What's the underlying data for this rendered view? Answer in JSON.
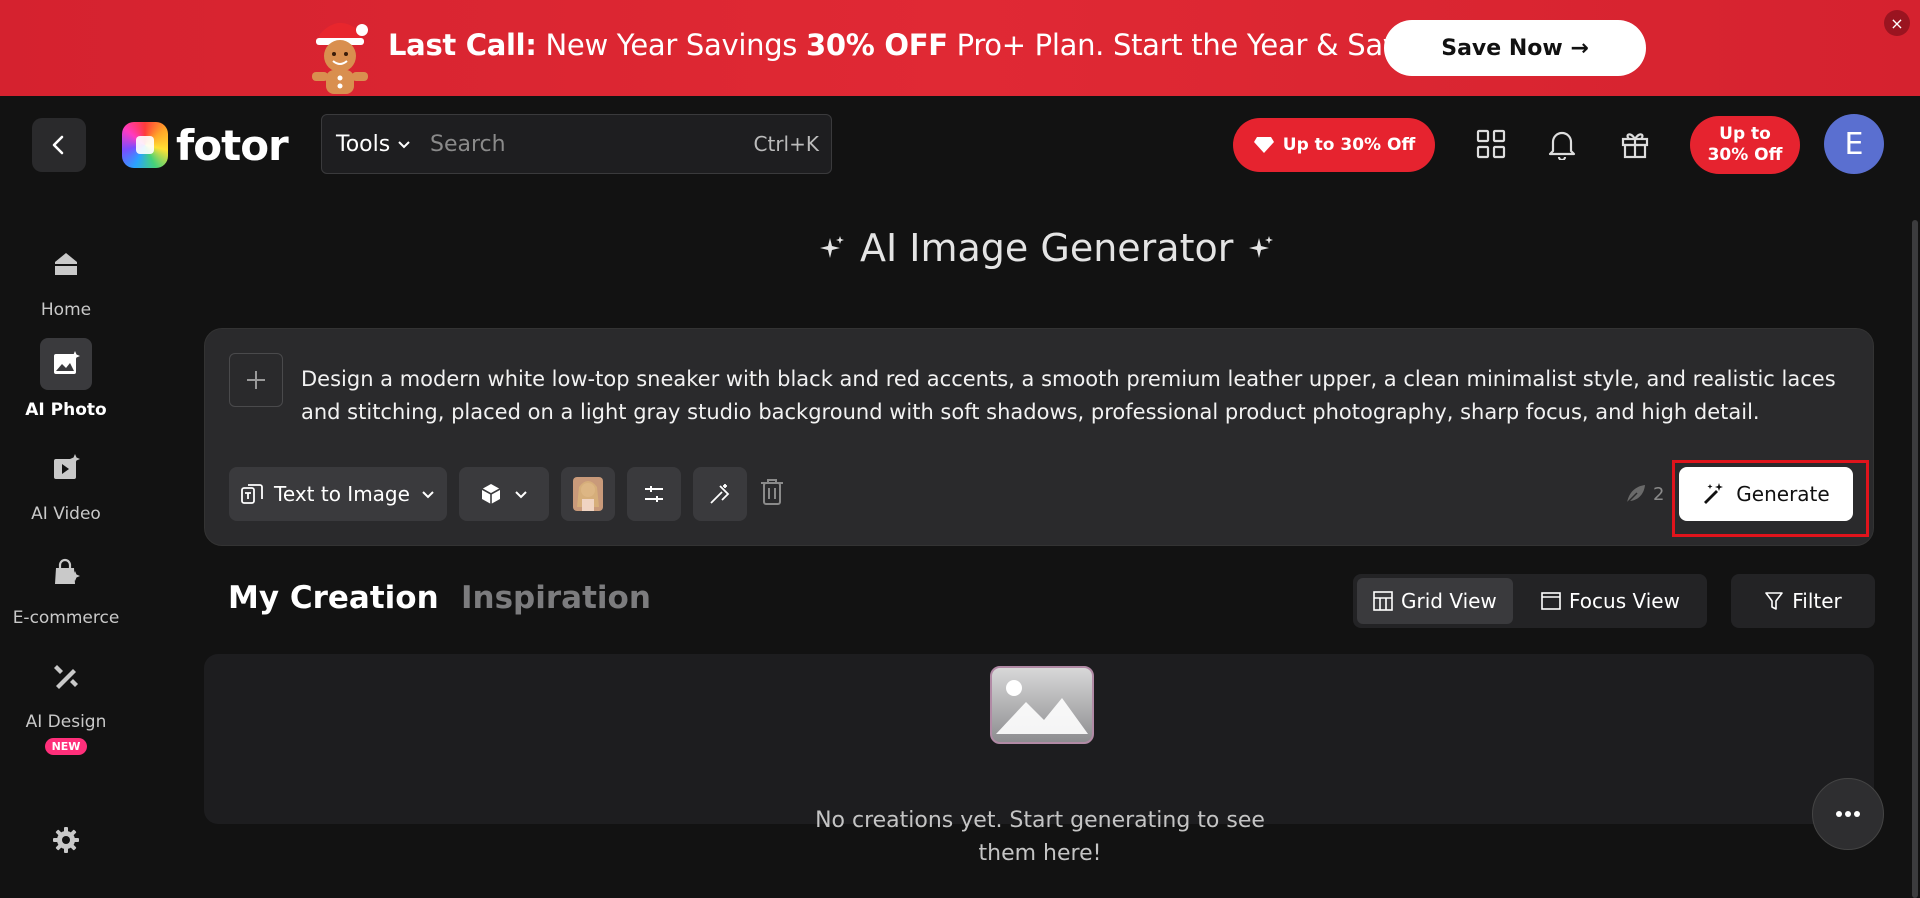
{
  "promo": {
    "bold_lead": "Last Call:",
    "text1": " New Year Savings ",
    "bold_offer": "30% OFF",
    "text2": " Pro+ Plan. Start the Year & Save!",
    "cta": "Save Now →",
    "close": "×"
  },
  "header": {
    "logo": "fotor",
    "tools_label": "Tools",
    "search_placeholder": "Search",
    "shortcut": "Ctrl+K",
    "deal_pill": "Up to 30% Off",
    "deal_round_line1": "Up to",
    "deal_round_line2": "30% Off",
    "avatar_initial": "E"
  },
  "sidebar": {
    "items": [
      {
        "label": "Home",
        "icon": "home-icon"
      },
      {
        "label": "AI Photo",
        "icon": "ai-photo-icon"
      },
      {
        "label": "AI Video",
        "icon": "ai-video-icon"
      },
      {
        "label": "E-commerce",
        "icon": "shopping-bag-icon"
      },
      {
        "label": "AI Design",
        "icon": "ai-design-icon"
      }
    ],
    "new_badge": "NEW"
  },
  "main": {
    "title": "AI Image Generator",
    "prompt": "Design a modern white low-top sneaker with black and red accents, a smooth premium leather upper, a clean minimalist style, and realistic laces and stitching, placed on a light gray studio background with soft shadows, professional product photography, sharp focus, and high detail.",
    "mode_label": "Text to Image",
    "credits": "2",
    "generate_label": "Generate"
  },
  "tabs": {
    "my_creation": "My Creation",
    "inspiration": "Inspiration"
  },
  "views": {
    "grid": "Grid View",
    "focus": "Focus View",
    "filter": "Filter"
  },
  "empty": {
    "message": "No creations yet. Start generating to see them here!"
  },
  "colors": {
    "accent_red": "#e6232f",
    "background": "#121212",
    "card": "#2a2a2c",
    "highlight_outline": "#e0141c"
  }
}
